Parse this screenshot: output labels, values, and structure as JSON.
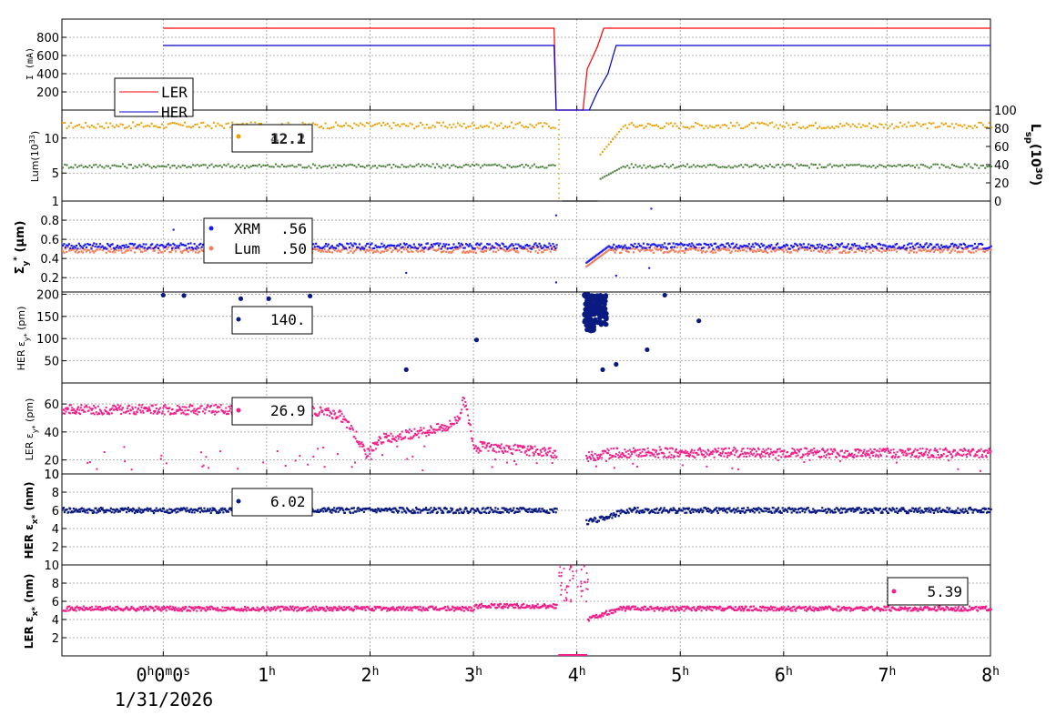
{
  "chart_data": [
    {
      "type": "line",
      "ylabel": "I (mA)",
      "ylim": [
        0,
        1000
      ],
      "yticks": [
        200,
        400,
        600,
        800
      ],
      "legend_position": "top-left",
      "series": [
        {
          "name": "LER",
          "color": "#ff0000",
          "x": [
            0,
            3.78,
            3.8,
            3.82,
            4.06,
            4.1,
            4.2,
            4.26,
            4.3,
            8.0
          ],
          "y": [
            900,
            900,
            0,
            0,
            0,
            450,
            700,
            900,
            900,
            900
          ]
        },
        {
          "name": "HER",
          "color": "#0000cc",
          "x": [
            0,
            3.78,
            3.8,
            3.82,
            4.12,
            4.2,
            4.3,
            4.38,
            4.45,
            8.0
          ],
          "y": [
            710,
            710,
            0,
            0,
            0,
            200,
            400,
            710,
            710,
            710
          ]
        }
      ]
    },
    {
      "type": "scatter",
      "ylabel": "Lum(10",
      "ylabel_exp": "33",
      "ylabel_close": ")",
      "ylim": [
        1,
        14
      ],
      "yticks": [
        1,
        5,
        10
      ],
      "y2label": "L",
      "y2label_sub": "sp",
      "y2label_mid": "(10",
      "y2label_exp": "30",
      "y2label_close": ")",
      "y2lim": [
        0,
        100
      ],
      "y2ticks": [
        0,
        20,
        40,
        60,
        80,
        100
      ],
      "legend_position": "top-center",
      "legend_values": [
        "12.1",
        "42.2"
      ],
      "series": [
        {
          "color": "#e8a000",
          "y": 11.8,
          "gap": [
            3.8,
            4.2
          ]
        },
        {
          "color": "#4a7f3a",
          "y": 6.0,
          "gap": [
            3.8,
            4.2
          ]
        }
      ]
    },
    {
      "type": "scatter",
      "ylabel": "Σ",
      "ylabel_sub": "y",
      "ylabel_sup": "*",
      "ylabel_unit": "(μm)",
      "ylim": [
        0.05,
        1.0
      ],
      "yticks": [
        0.2,
        0.4,
        0.6,
        0.8
      ],
      "legend_position": "top-center",
      "series": [
        {
          "name": "XRM",
          "value": ".56",
          "color": "#1a1aee",
          "y": 0.53
        },
        {
          "name": "Lum",
          "value": ".50",
          "color": "#f08060",
          "y": 0.49
        }
      ]
    },
    {
      "type": "scatter",
      "ylabel": "HER ε",
      "ylabel_sub": "y*",
      "ylabel_unit": "(pm)",
      "ylim": [
        0,
        205
      ],
      "yticks": [
        50,
        100,
        150,
        200
      ],
      "legend_position": "top-center",
      "legend_value": "140.",
      "series": [
        {
          "color": "#0a1a80",
          "x": [
            0.0,
            0.2,
            0.75,
            1.02,
            1.42,
            2.35,
            3.03,
            4.25,
            4.38,
            4.68,
            4.85,
            5.18
          ],
          "y": [
            198,
            197,
            190,
            190,
            196,
            30,
            97,
            30,
            42,
            75,
            198,
            140
          ]
        }
      ]
    },
    {
      "type": "scatter",
      "ylabel": "LER ε",
      "ylabel_sub": "y*",
      "ylabel_unit": "(pm)",
      "ylim": [
        10,
        75
      ],
      "yticks": [
        10,
        20,
        40,
        60
      ],
      "legend_position": "top-center",
      "legend_value": "26.9",
      "series": [
        {
          "color": "#f0208a",
          "x": [
            0,
            0.5,
            1.0,
            1.5,
            1.7,
            1.85,
            1.95,
            2.1,
            2.5,
            2.75,
            2.85,
            2.9,
            3.0,
            3.78,
            4.1,
            4.3,
            8.0
          ],
          "y": [
            56,
            56,
            55,
            55,
            52,
            38,
            24,
            35,
            40,
            44,
            50,
            64,
            30,
            25,
            22,
            25,
            25
          ]
        }
      ]
    },
    {
      "type": "scatter",
      "ylabel": "HER ε",
      "ylabel_sub": "x*",
      "ylabel_unit": "(nm)",
      "ylim": [
        0,
        10
      ],
      "yticks": [
        2,
        4,
        6,
        8,
        10
      ],
      "legend_position": "top-center",
      "legend_value": "6.02",
      "series": [
        {
          "color": "#0a1a80",
          "y": 6.0
        }
      ]
    },
    {
      "type": "scatter",
      "ylabel": "LER ε",
      "ylabel_sub": "x*",
      "ylabel_unit": "(nm)",
      "ylim": [
        0,
        10
      ],
      "yticks": [
        2,
        4,
        6,
        8,
        10
      ],
      "legend_position": "top-right",
      "legend_value": "5.39",
      "series": [
        {
          "color": "#f0208a",
          "y": 5.2
        }
      ]
    }
  ],
  "x_axis": {
    "range": [
      -0.98,
      8.0
    ],
    "ticks": [
      {
        "v": 0,
        "label": "0",
        "sup": "h",
        "label2": "0",
        "sup2": "m",
        "label3": "0",
        "sup3": "s"
      },
      {
        "v": 1,
        "label": "1",
        "sup": "h"
      },
      {
        "v": 2,
        "label": "2",
        "sup": "h"
      },
      {
        "v": 3,
        "label": "3",
        "sup": "h"
      },
      {
        "v": 4,
        "label": "4",
        "sup": "h"
      },
      {
        "v": 5,
        "label": "5",
        "sup": "h"
      },
      {
        "v": 6,
        "label": "6",
        "sup": "h"
      },
      {
        "v": 7,
        "label": "7",
        "sup": "h"
      },
      {
        "v": 8,
        "label": "8",
        "sup": "h"
      }
    ],
    "date": "1/31/2026"
  }
}
